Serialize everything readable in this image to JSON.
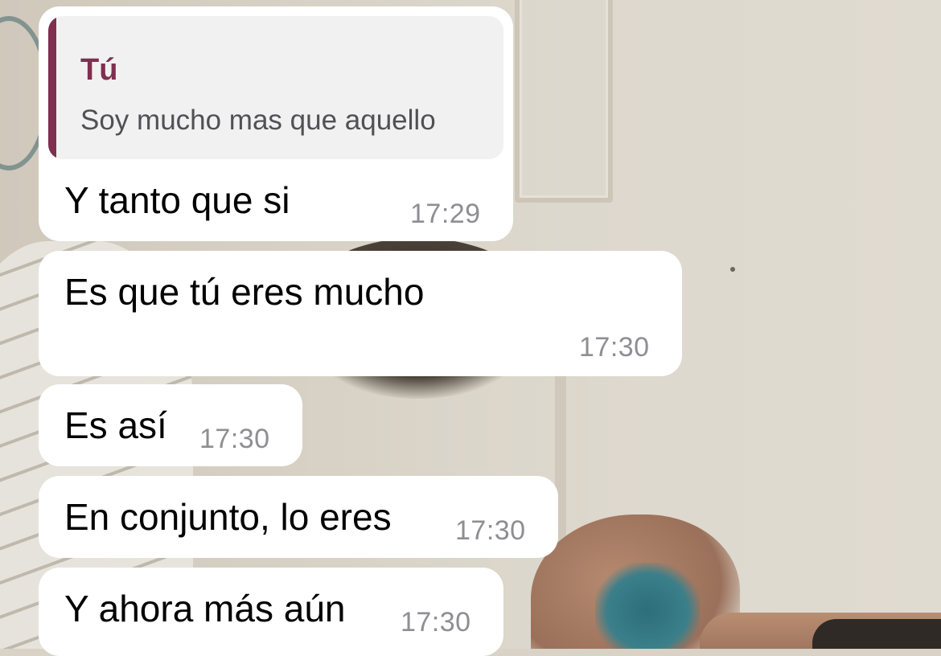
{
  "colors": {
    "bubble_background": "#ffffff",
    "quote_accent": "#7f2f4f",
    "quote_background": "#f1f1f2",
    "timestamp": "#8e8e93",
    "message_text": "#000000"
  },
  "messages": [
    {
      "reply_to": {
        "author": "Tú",
        "text": "Soy mucho mas que aquello"
      },
      "text": "Y tanto que si",
      "time": "17:29"
    },
    {
      "text": "Es que tú eres mucho",
      "time": "17:30"
    },
    {
      "text": "Es así",
      "time": "17:30"
    },
    {
      "text": "En conjunto, lo eres",
      "time": "17:30"
    },
    {
      "text": "Y ahora más aún",
      "time": "17:30"
    }
  ]
}
